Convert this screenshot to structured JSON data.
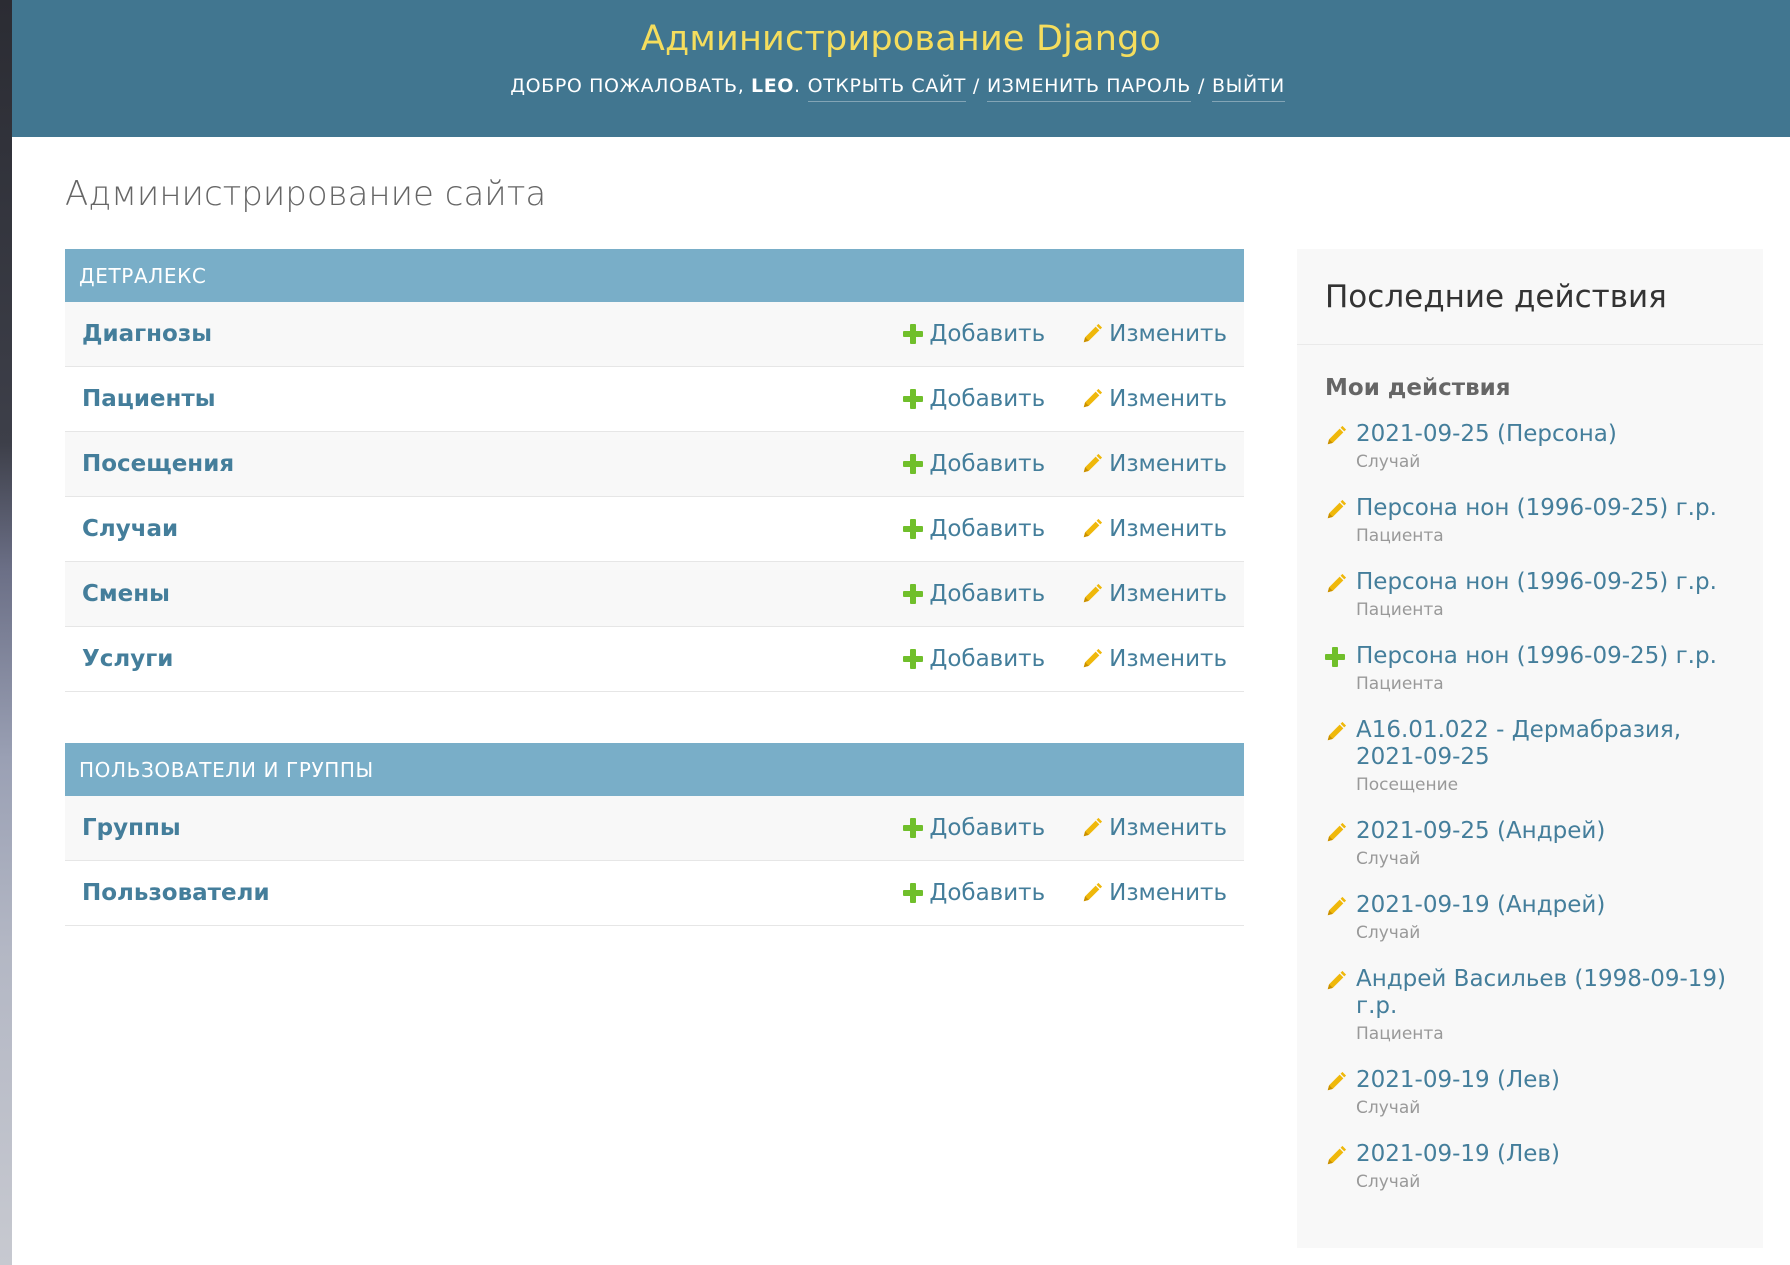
{
  "header": {
    "branding": "Администрирование Django",
    "welcome": "Добро пожаловать,",
    "username": "leo",
    "view_site": "Открыть сайт",
    "change_password": "Изменить пароль",
    "logout": "Выйти",
    "separator": "/"
  },
  "page_title": "Администрирование сайта",
  "add_label": "Добавить",
  "change_label": "Изменить",
  "modules": [
    {
      "caption": "Детралекс",
      "models": [
        "Диагнозы",
        "Пациенты",
        "Посещения",
        "Случаи",
        "Смены",
        "Услуги"
      ]
    },
    {
      "caption": "Пользователи и группы",
      "models": [
        "Группы",
        "Пользователи"
      ]
    }
  ],
  "sidebar": {
    "title": "Последние действия",
    "subtitle": "Мои действия",
    "actions": [
      {
        "icon": "pencil-icon",
        "object": "2021-09-25 (Персона)",
        "type": "Случай"
      },
      {
        "icon": "pencil-icon",
        "object": "Персона нон (1996-09-25) г.р.",
        "type": "Пациента"
      },
      {
        "icon": "pencil-icon",
        "object": "Персона нон (1996-09-25) г.р.",
        "type": "Пациента"
      },
      {
        "icon": "plus-icon",
        "object": "Персона нон (1996-09-25) г.р.",
        "type": "Пациента"
      },
      {
        "icon": "pencil-icon",
        "object": "A16.01.022 - Дермабразия, 2021-09-25",
        "type": "Посещение"
      },
      {
        "icon": "pencil-icon",
        "object": "2021-09-25 (Андрей)",
        "type": "Случай"
      },
      {
        "icon": "pencil-icon",
        "object": "2021-09-19 (Андрей)",
        "type": "Случай"
      },
      {
        "icon": "pencil-icon",
        "object": "Андрей Васильев (1998-09-19) г.р.",
        "type": "Пациента"
      },
      {
        "icon": "pencil-icon",
        "object": "2021-09-19 (Лев)",
        "type": "Случай"
      },
      {
        "icon": "pencil-icon",
        "object": "2021-09-19 (Лев)",
        "type": "Случай"
      }
    ]
  },
  "colors": {
    "header_bg": "#417690",
    "branding": "#f5dd5d",
    "caption_bg": "#79aec8",
    "link": "#447e9b",
    "add_icon": "#70bf2b",
    "change_icon": "#efb80b"
  }
}
